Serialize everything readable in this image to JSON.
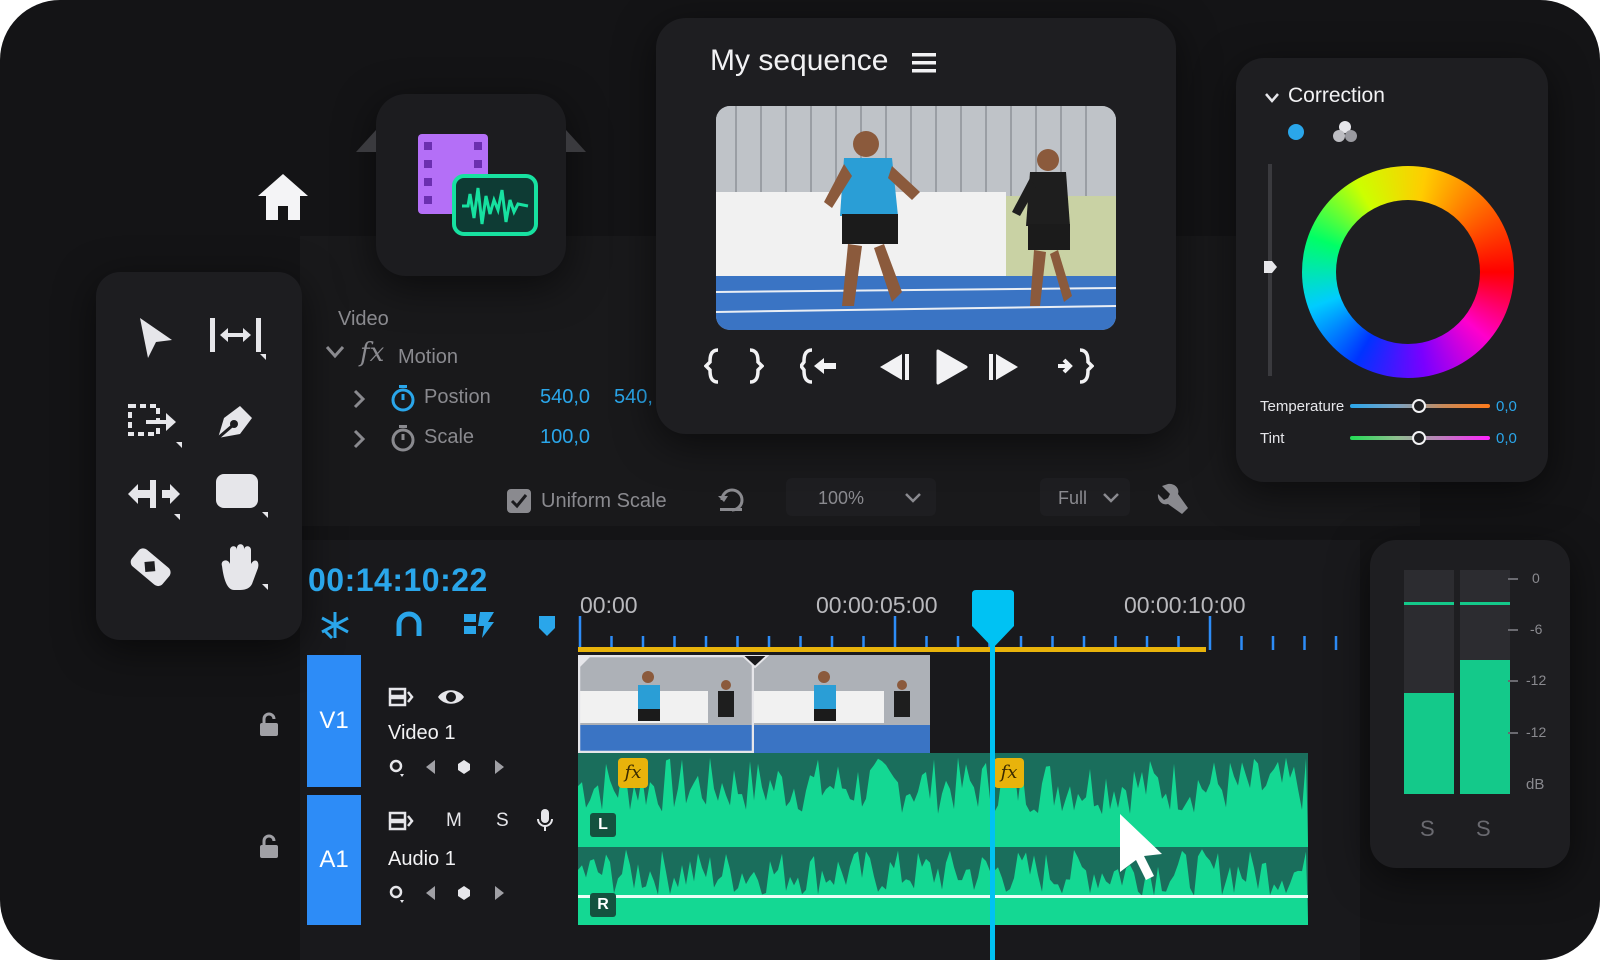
{
  "colors": {
    "accent": "#00c2f3",
    "clip_green": "#12d890",
    "clip_green_dark": "#1a6e5c",
    "track_blue": "#2d8cf7",
    "work_area": "#e8b30b",
    "timecode": "#2aa6ea"
  },
  "sequence": {
    "title": "My sequence",
    "menu_icon": "hamburger-icon"
  },
  "effect_controls": {
    "section": "Video",
    "effect_name": "Motion",
    "position_label": "Postion",
    "position_x": "540,0",
    "position_y": "540,",
    "scale_label": "Scale",
    "scale_value": "100,0",
    "uniform_scale_label": "Uniform Scale",
    "uniform_scale_checked": true
  },
  "viewer": {
    "zoom": "100%",
    "quality": "Full"
  },
  "correction": {
    "title": "Correction",
    "temperature_label": "Temperature",
    "temperature_value": "0,0",
    "tint_label": "Tint",
    "tint_value": "0,0"
  },
  "timeline": {
    "timecode": "00:14:10:22",
    "ruler": [
      "00:00",
      "00:00:05:00",
      "00:00:10:00"
    ],
    "tracks": [
      {
        "id": "V1",
        "name": "Video 1"
      },
      {
        "id": "A1",
        "name": "Audio 1",
        "mute": "M",
        "solo": "S"
      }
    ],
    "channels": [
      "L",
      "R"
    ],
    "fx_badge": "fx"
  },
  "meters": {
    "scale": [
      "0",
      "-6",
      "-12",
      "-12",
      "dB"
    ],
    "solo": [
      "S",
      "S"
    ],
    "levels": [
      0.45,
      0.6
    ]
  }
}
